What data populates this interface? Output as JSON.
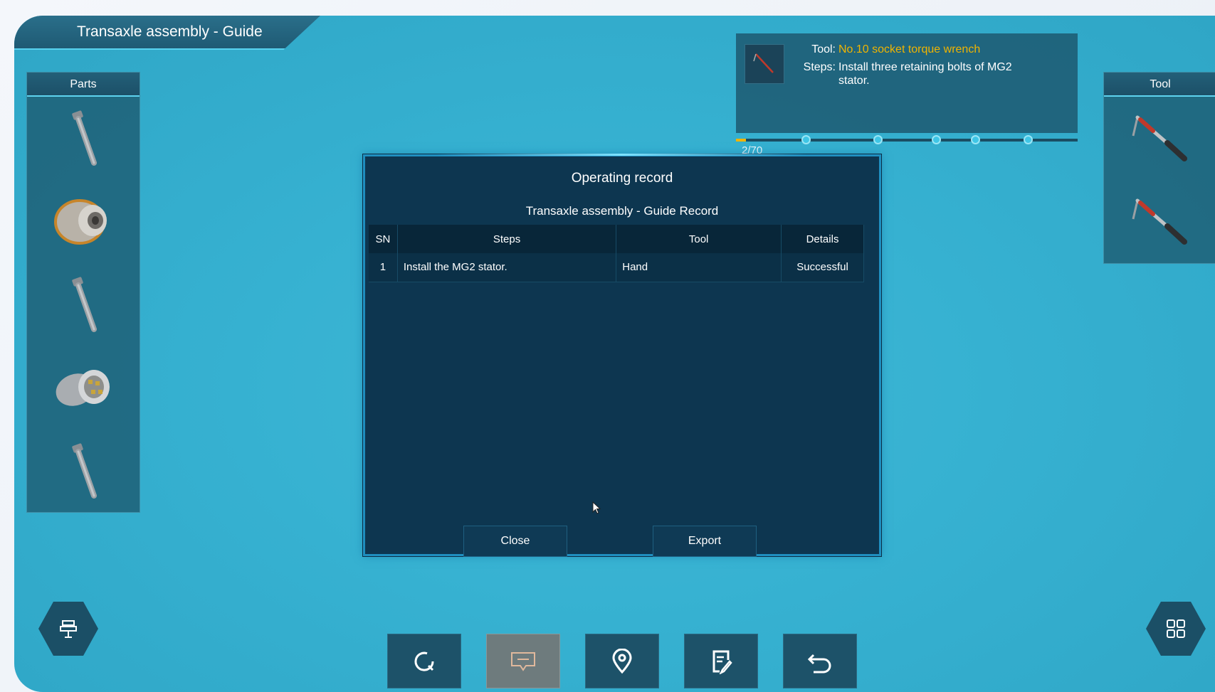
{
  "window": {
    "title": "Transaxle assembly - Guide"
  },
  "parts_panel": {
    "header": "Parts",
    "items": [
      {
        "icon": "bolt-icon"
      },
      {
        "icon": "stator-icon"
      },
      {
        "icon": "bolt-icon"
      },
      {
        "icon": "rotor-icon"
      },
      {
        "icon": "bolt-icon"
      }
    ]
  },
  "tool_panel": {
    "header": "Tool",
    "items": [
      {
        "icon": "torque-wrench-icon"
      },
      {
        "icon": "torque-wrench-icon"
      }
    ]
  },
  "guide": {
    "tool_label": "Tool:",
    "tool_value": "No.10 socket torque wrench",
    "steps_label": "Steps:",
    "steps_value_line1": "Install three retaining bolts of MG2",
    "steps_value_line2": "stator.",
    "progress_text": "2/70",
    "progress_fraction": 0.0286
  },
  "modal": {
    "title": "Operating record",
    "subtitle": "Transaxle assembly - Guide  Record",
    "columns": {
      "sn": "SN",
      "steps": "Steps",
      "tool": "Tool",
      "details": "Details"
    },
    "rows": [
      {
        "sn": "1",
        "steps": "Install the MG2 stator.",
        "tool": "Hand",
        "details": "Successful"
      }
    ],
    "close_label": "Close",
    "export_label": "Export"
  },
  "toolbar": {
    "items": [
      {
        "icon": "reset-icon"
      },
      {
        "icon": "comment-icon",
        "active": true
      },
      {
        "icon": "location-pin-icon"
      },
      {
        "icon": "record-edit-icon"
      },
      {
        "icon": "undo-icon"
      }
    ]
  },
  "colors": {
    "accent": "#f0b400",
    "background": "#36b1d1",
    "panel": "#0d3650"
  }
}
